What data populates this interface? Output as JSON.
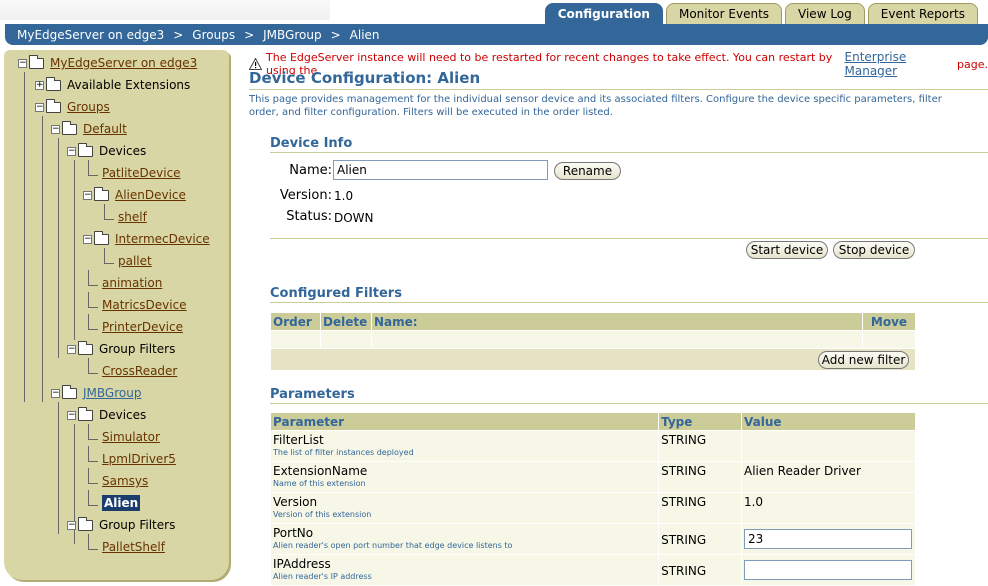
{
  "tabs": [
    "Configuration",
    "Monitor Events",
    "View Log",
    "Event Reports"
  ],
  "breadcrumb": [
    "MyEdgeServer on edge3",
    "Groups",
    "JMBGroup",
    "Alien"
  ],
  "breadcrumb_sep": ">",
  "tree": {
    "root": "MyEdgeServer on edge3",
    "available_extensions": "Available Extensions",
    "groups": "Groups",
    "default": "Default",
    "devices": "Devices",
    "patlite": "PatliteDevice",
    "alien_device": "AlienDevice",
    "shelf": "shelf",
    "intermec": "IntermecDevice",
    "pallet": "pallet",
    "animation": "animation",
    "matrics": "MatricsDevice",
    "printer": "PrinterDevice",
    "group_filters": "Group Filters",
    "crossreader": "CrossReader",
    "jmbgroup": "JMBGroup",
    "devices2": "Devices",
    "simulator": "Simulator",
    "lpml": "LpmlDriver5",
    "samsys": "Samsys",
    "alien": "Alien",
    "group_filters2": "Group Filters",
    "palletshelf": "PalletShelf"
  },
  "warning": {
    "text": "The EdgeServer instance will need to be restarted for recent changes to take effect. You can restart by using the",
    "link": "Enterprise Manager",
    "tail": "page."
  },
  "page": {
    "title": "Device Configuration: Alien",
    "description": "This page provides management for the individual sensor device and its associated filters. Configure the device specific parameters, filter order, and filter configuration. Filters will be executed in the order listed."
  },
  "device_info": {
    "heading": "Device Info",
    "name_label": "Name:",
    "name_value": "Alien",
    "rename": "Rename",
    "version_label": "Version:",
    "version_value": "1.0",
    "status_label": "Status:",
    "status_value": "DOWN",
    "start": "Start device",
    "stop": "Stop device"
  },
  "filters": {
    "heading": "Configured Filters",
    "columns": [
      "Order",
      "Delete",
      "Name:",
      "Move"
    ],
    "add": "Add new filter"
  },
  "parameters": {
    "heading": "Parameters",
    "columns": [
      "Parameter",
      "Type",
      "Value"
    ],
    "rows": [
      {
        "name": "FilterList",
        "desc": "The list of filter instances deployed",
        "type": "STRING",
        "value": ""
      },
      {
        "name": "ExtensionName",
        "desc": "Name of this extension",
        "type": "STRING",
        "value": "Alien Reader Driver"
      },
      {
        "name": "Version",
        "desc": "Version of this extension",
        "type": "STRING",
        "value": "1.0"
      },
      {
        "name": "PortNo",
        "desc": "Alien reader's open port number that edge device listens to",
        "type": "STRING",
        "value": "23"
      },
      {
        "name": "IPAddress",
        "desc": "Alien reader's IP address",
        "type": "STRING",
        "value": ""
      }
    ]
  },
  "colors": {
    "accent": "#336699",
    "panel": "#d9d6a5",
    "link": "#663300",
    "warning": "#cc0000"
  },
  "icons": [
    "warning-icon",
    "folder-icon",
    "expand-toggle-icon",
    "collapse-toggle-icon"
  ]
}
